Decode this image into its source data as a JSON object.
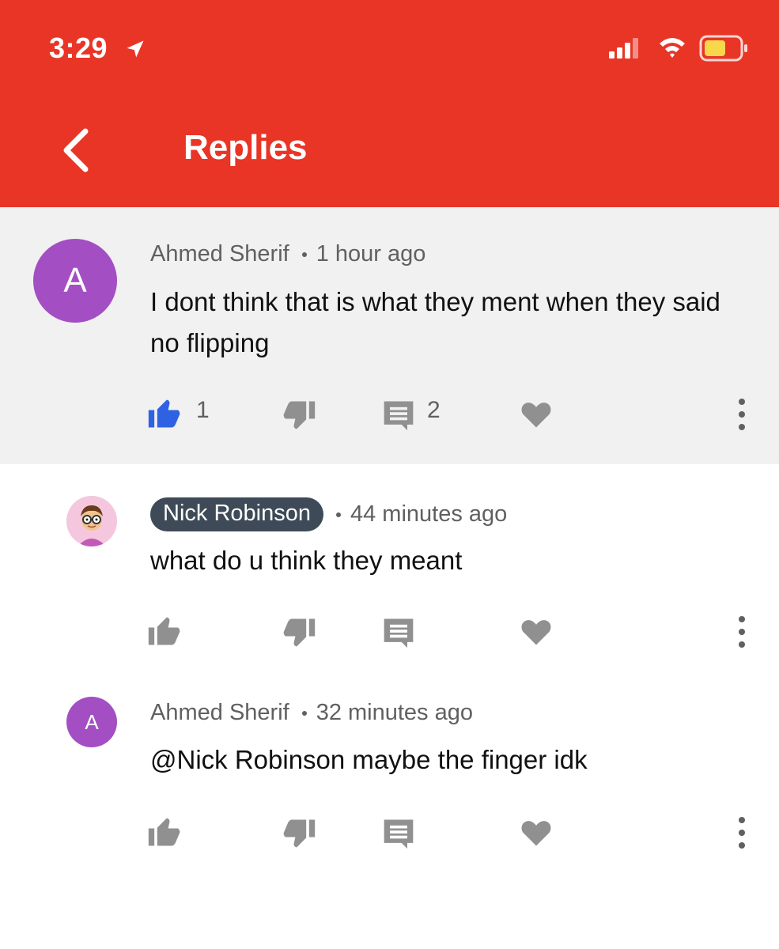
{
  "status_bar": {
    "time": "3:29"
  },
  "header": {
    "title": "Replies"
  },
  "colors": {
    "header_bg": "#e83526",
    "avatar_purple": "#a34fc3",
    "like_active": "#2f62e3",
    "icon_gray": "#909090",
    "chip_bg": "#3e4a57"
  },
  "comments": [
    {
      "author": "Ahmed Sherif",
      "time": "1 hour ago",
      "avatar_letter": "A",
      "text": "I dont think that is what they ment when they said no flipping",
      "like_count": "1",
      "reply_count": "2",
      "liked": true
    },
    {
      "author": "Nick Robinson",
      "time": "44 minutes ago",
      "avatar_icon": "cartoon-avatar-icon",
      "text": "what do u think they meant"
    },
    {
      "author": "Ahmed Sherif",
      "time": "32 minutes ago",
      "avatar_letter": "A",
      "text": "@Nick Robinson maybe the finger idk"
    }
  ]
}
